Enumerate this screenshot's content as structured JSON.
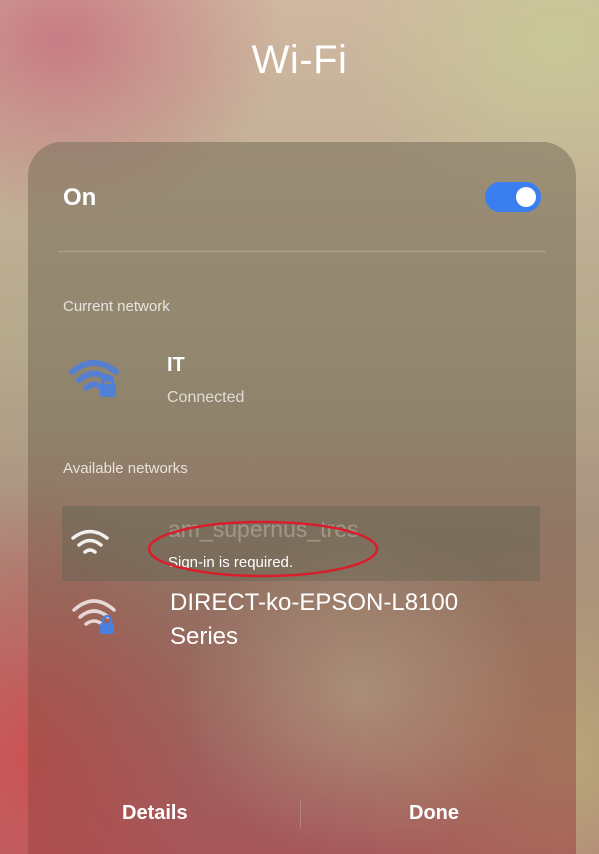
{
  "page": {
    "title": "Wi-Fi"
  },
  "toggle": {
    "label": "On",
    "state": "on",
    "color": "#3b7ef0"
  },
  "current": {
    "section_label": "Current network",
    "network": {
      "name": "IT",
      "status": "Connected",
      "icon": "wifi-lock-icon"
    }
  },
  "available": {
    "section_label": "Available networks",
    "networks": [
      {
        "name": "am_supernus_tres",
        "status": "Sign-in is required.",
        "icon": "wifi-icon",
        "highlighted": true,
        "annotation": "red-ellipse"
      },
      {
        "name": "DIRECT-ko-EPSON-L8100 Series",
        "icon": "wifi-lock-icon"
      }
    ]
  },
  "footer": {
    "details_label": "Details",
    "done_label": "Done"
  },
  "colors": {
    "annotation": "#d81e2c",
    "wifi_blue": "#4b7fe0"
  }
}
